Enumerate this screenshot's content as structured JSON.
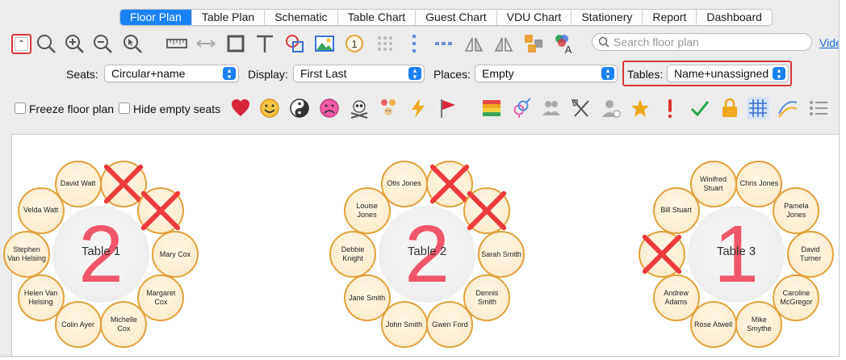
{
  "tabs": [
    "Floor Plan",
    "Table Plan",
    "Schematic",
    "Table Chart",
    "Guest Chart",
    "VDU Chart",
    "Stationery",
    "Report",
    "Dashboard"
  ],
  "active_tab": "Floor Plan",
  "toolbar": {
    "collapse_glyph": "⌃",
    "search_placeholder": "Search floor plan",
    "video_link": "Video",
    "place_number": "1",
    "icons": [
      "zoom-icon",
      "zoom-in-icon",
      "zoom-out-icon",
      "select-icon",
      "ruler-icon",
      "resize-icon",
      "rectangle-icon",
      "text-icon",
      "shapes-icon",
      "image-icon",
      "place-number-icon",
      "grid-dots-icon",
      "vertical-dots-icon",
      "horizontal-dots-icon",
      "flip-icon",
      "mirror-icon",
      "arrange-icon",
      "color-text-icon"
    ]
  },
  "controls": {
    "seats_label": "Seats:",
    "seats_value": "Circular+name",
    "display_label": "Display:",
    "display_value": "First Last",
    "places_label": "Places:",
    "places_value": "Empty",
    "tables_label": "Tables:",
    "tables_value": "Name+unassigned"
  },
  "options": {
    "freeze_label": "Freeze floor plan",
    "hide_empty_label": "Hide empty seats",
    "icons": [
      "heart-icon",
      "smiley-icon",
      "yin-yang-icon",
      "frown-icon",
      "skull-icon",
      "family-icon",
      "lightning-icon",
      "flag-icon",
      "color-bars-icon",
      "gender-icon",
      "people-icon",
      "utensils-icon",
      "person-icon",
      "star-icon",
      "exclamation-icon",
      "check-icon",
      "lock-icon",
      "grid-icon",
      "lines-icon",
      "list-icon"
    ]
  },
  "tables": [
    {
      "name": "Table 1",
      "unassigned": "2",
      "seats": [
        "",
        "",
        "Mary Cox",
        "Margaret Cox",
        "Michelle Cox",
        "Colin Ayer",
        "Helen Van Helsing",
        "Stephen Van Helsing",
        "Velda Watt",
        "David Watt"
      ]
    },
    {
      "name": "Table 2",
      "unassigned": "2",
      "seats": [
        "",
        "",
        "Sarah Smith",
        "Dennis Smith",
        "Gwen Ford",
        "John Smith",
        "Jane Smith",
        "Debbie Knight",
        "Louise Jones",
        "Otis Jones"
      ]
    },
    {
      "name": "Table 3",
      "unassigned": "1",
      "seats": [
        "Chris Jones",
        "Pamela Jones",
        "David Turner",
        "Caroline McGregor",
        "Mike Smythe",
        "Rose Atwell",
        "Andrew Adams",
        "",
        "Bill Stuart",
        "Winifred Stuart"
      ]
    }
  ],
  "colors": {
    "accent": "#1a82f7",
    "highlight": "#d8373c",
    "seat_border": "#e2a13b",
    "table_number": "#f0566b",
    "empty_cross": "#ee3b3b"
  }
}
